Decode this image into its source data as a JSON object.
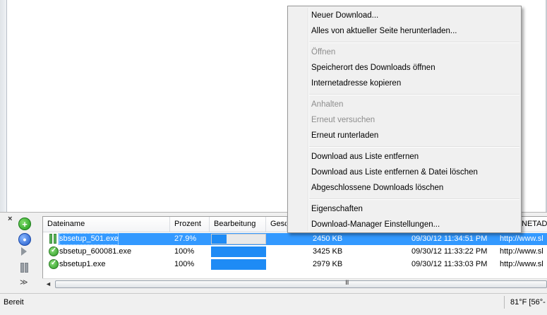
{
  "context_menu": {
    "items": [
      {
        "label": "Neuer Download...",
        "enabled": true
      },
      {
        "label": "Alles von aktueller Seite herunterladen...",
        "enabled": true
      },
      {
        "label": "Öffnen",
        "enabled": false
      },
      {
        "label": "Speicherort des Downloads öffnen",
        "enabled": true
      },
      {
        "label": "Internetadresse kopieren",
        "enabled": true
      },
      {
        "label": "Anhalten",
        "enabled": false
      },
      {
        "label": "Erneut versuchen",
        "enabled": false
      },
      {
        "label": "Erneut runterladen",
        "enabled": true
      },
      {
        "label": "Download aus Liste entfernen",
        "enabled": true
      },
      {
        "label": "Download aus Liste entfernen & Datei löschen",
        "enabled": true
      },
      {
        "label": "Abgeschlossene Downloads löschen",
        "enabled": true
      },
      {
        "label": "Eigenschaften",
        "enabled": true
      },
      {
        "label": "Download-Manager Einstellungen...",
        "enabled": true
      }
    ]
  },
  "download_panel": {
    "close_label": "×",
    "toolbar": {
      "add_icon": "plus-circle-icon",
      "options_icon": "options-circle-icon",
      "resume_icon": "play-icon",
      "pause_icon": "pause-icon",
      "more_label": "≫"
    },
    "columns": [
      "Dateiname",
      "Prozent",
      "Bearbeitung",
      "Gesc",
      "NETADR"
    ],
    "rows": [
      {
        "name": "sbsetup_501.exe",
        "percent": "27.9%",
        "progress": 0.279,
        "size": "2450 KB",
        "date": "09/30/12 11:34:51 PM",
        "url": "http://www.sl",
        "status": "paused",
        "selected": true
      },
      {
        "name": "sbsetup_600081.exe",
        "percent": "100%",
        "progress": 1.0,
        "size": "3425 KB",
        "date": "09/30/12 11:33:22 PM",
        "url": "http://www.sl",
        "status": "complete",
        "selected": false
      },
      {
        "name": "sbsetup1.exe",
        "percent": "100%",
        "progress": 1.0,
        "size": "2979 KB",
        "date": "09/30/12 11:33:03 PM",
        "url": "http://www.sl",
        "status": "complete",
        "selected": false
      }
    ],
    "scroll_grip": "III"
  },
  "statusbar": {
    "text": "Bereit",
    "weather": "81°F [56°-"
  },
  "colors": {
    "selection": "#3399ff",
    "progress": "#1e8bf5"
  }
}
